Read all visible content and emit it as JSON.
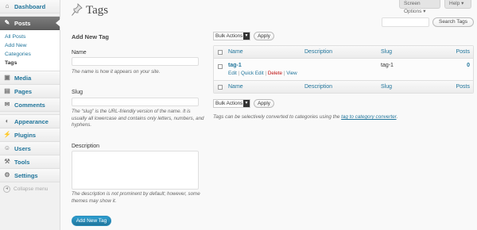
{
  "sidebar": {
    "items": [
      {
        "label": "Dashboard",
        "icon": "dashboard-icon",
        "glyph": "⌂"
      },
      {
        "label": "Posts",
        "icon": "pin-icon",
        "glyph": "✎"
      },
      {
        "label": "Media",
        "icon": "media-icon",
        "glyph": "▣"
      },
      {
        "label": "Pages",
        "icon": "page-icon",
        "glyph": "▤"
      },
      {
        "label": "Comments",
        "icon": "comments-icon",
        "glyph": "✉"
      },
      {
        "label": "Appearance",
        "icon": "appearance-icon",
        "glyph": "◐"
      },
      {
        "label": "Plugins",
        "icon": "plugins-icon",
        "glyph": "⚡"
      },
      {
        "label": "Users",
        "icon": "users-icon",
        "glyph": "☺"
      },
      {
        "label": "Tools",
        "icon": "tools-icon",
        "glyph": "⚒"
      },
      {
        "label": "Settings",
        "icon": "settings-icon",
        "glyph": "⚙"
      }
    ],
    "posts_submenu": [
      "All Posts",
      "Add New",
      "Categories",
      "Tags"
    ],
    "collapse_label": "Collapse menu"
  },
  "top": {
    "screen_options": "Screen Options ▾",
    "help": "Help ▾"
  },
  "page": {
    "title": "Tags",
    "search_button": "Search Tags"
  },
  "form": {
    "title": "Add New Tag",
    "name_label": "Name",
    "name_desc": "The name is how it appears on your site.",
    "slug_label": "Slug",
    "slug_desc": "The “slug” is the URL-friendly version of the name. It is usually all lowercase and contains only letters, numbers, and hyphens.",
    "description_label": "Description",
    "description_desc": "The description is not prominent by default; however, some themes may show it.",
    "submit": "Add New Tag"
  },
  "bulk": {
    "select_label": "Bulk Actions",
    "apply": "Apply"
  },
  "table": {
    "columns": {
      "name": "Name",
      "description": "Description",
      "slug": "Slug",
      "posts": "Posts"
    },
    "rows": [
      {
        "name": "tag-1",
        "description": "",
        "slug": "tag-1",
        "posts": "0",
        "actions": {
          "edit": "Edit",
          "quick_edit": "Quick Edit",
          "delete": "Delete",
          "view": "View"
        }
      }
    ]
  },
  "note": {
    "text": "Tags can be selectively converted to categories using the ",
    "link": "tag to category converter",
    "suffix": "."
  },
  "colors": {
    "link": "#21759b",
    "primary_button": "#21759b",
    "delete": "#bc0b0b"
  }
}
